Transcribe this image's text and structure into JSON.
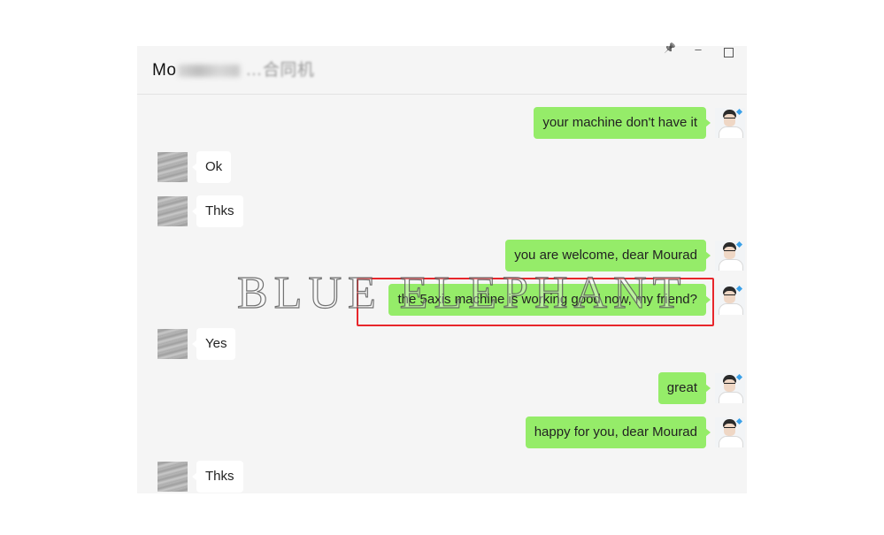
{
  "window": {
    "title_visible": "Mo",
    "title_tail": "…合同机",
    "controls": {
      "pin": "📌",
      "minimize": "–",
      "maximize": ""
    }
  },
  "messages": [
    {
      "side": "me",
      "text": "your machine don't have it"
    },
    {
      "side": "them",
      "text": "Ok"
    },
    {
      "side": "them",
      "text": "Thks"
    },
    {
      "side": "me",
      "text": "you are welcome, dear Mourad"
    },
    {
      "side": "me",
      "text": "the 5axis machine is working good now, my friend?",
      "highlighted": true
    },
    {
      "side": "them",
      "text": "Yes"
    },
    {
      "side": "me",
      "text": "great"
    },
    {
      "side": "me",
      "text": "happy for you, dear Mourad"
    },
    {
      "side": "them",
      "text": "Thks"
    }
  ],
  "watermark": "BLUE ELEPHANT",
  "colors": {
    "my_bubble": "#95ec69",
    "their_bubble": "#ffffff",
    "chat_bg": "#f5f5f5",
    "highlight_box": "#e8262b"
  }
}
